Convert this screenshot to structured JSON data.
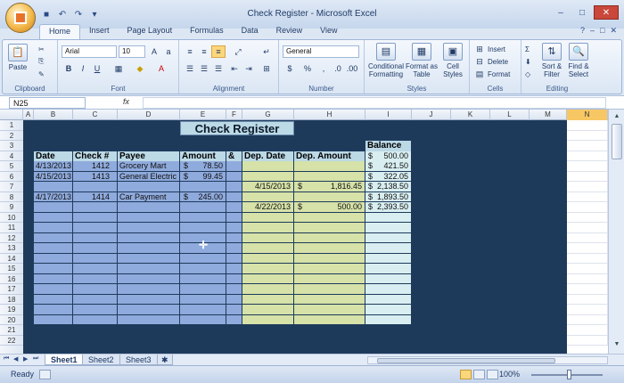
{
  "app": {
    "title": "Check Register - Microsoft Excel"
  },
  "tabs": [
    "Home",
    "Insert",
    "Page Layout",
    "Formulas",
    "Data",
    "Review",
    "View"
  ],
  "ribbon": {
    "clipboard": {
      "label": "Clipboard",
      "paste": "Paste"
    },
    "font": {
      "label": "Font",
      "name": "Arial",
      "size": "10",
      "bold": "B",
      "italic": "I",
      "underline": "U"
    },
    "alignment": {
      "label": "Alignment"
    },
    "number": {
      "label": "Number",
      "format": "General",
      "currency": "$",
      "percent": "%",
      "comma": ","
    },
    "styles": {
      "label": "Styles",
      "conditional": "Conditional Formatting",
      "format_table": "Format as Table",
      "cell_styles": "Cell Styles"
    },
    "cells": {
      "label": "Cells",
      "insert": "Insert",
      "delete": "Delete",
      "format": "Format"
    },
    "editing": {
      "label": "Editing",
      "sort": "Sort & Filter",
      "find": "Find & Select"
    }
  },
  "formula_bar": {
    "namebox": "N25",
    "fx": "fx",
    "value": ""
  },
  "columns": [
    "A",
    "B",
    "C",
    "D",
    "E",
    "F",
    "G",
    "H",
    "I",
    "J",
    "K",
    "L",
    "M",
    "N"
  ],
  "rows": [
    "1",
    "2",
    "3",
    "4",
    "5",
    "6",
    "7",
    "8",
    "9",
    "10",
    "11",
    "12",
    "13",
    "14",
    "15",
    "16",
    "17",
    "18",
    "19",
    "20",
    "21",
    "22"
  ],
  "sheet": {
    "title": "Check Register",
    "balance_header": "Balance",
    "headers": {
      "date": "Date",
      "check": "Check #",
      "payee": "Payee",
      "amount": "Amount",
      "amp": "&",
      "dep_date": "Dep. Date",
      "dep_amount": "Dep. Amount"
    },
    "transactions": [
      {
        "date": "4/13/2013",
        "check": "1412",
        "payee": "Grocery Mart",
        "amount_sym": "$",
        "amount": "78.50"
      },
      {
        "date": "4/15/2013",
        "check": "1413",
        "payee": "General Electric",
        "amount_sym": "$",
        "amount": "99.45"
      },
      {
        "date": "4/17/2013",
        "check": "1414",
        "payee": "Car Payment",
        "amount_sym": "$",
        "amount": "245.00"
      }
    ],
    "deposits": [
      {
        "date": "4/15/2013",
        "sym": "$",
        "amount": "1,816.45"
      },
      {
        "date": "4/22/2013",
        "sym": "$",
        "amount": "500.00"
      }
    ],
    "balances": [
      {
        "sym": "$",
        "value": "500.00"
      },
      {
        "sym": "$",
        "value": "421.50"
      },
      {
        "sym": "$",
        "value": "322.05"
      },
      {
        "sym": "$",
        "value": "2,138.50"
      },
      {
        "sym": "$",
        "value": "1,893.50"
      },
      {
        "sym": "$",
        "value": "2,393.50"
      }
    ]
  },
  "sheet_tabs": [
    "Sheet1",
    "Sheet2",
    "Sheet3"
  ],
  "status": {
    "ready": "Ready",
    "zoom": "100%"
  },
  "colors": {
    "ledger": "#8faadc",
    "deposit": "#d6e2a8",
    "balance": "#d9eef1",
    "background": "#1e3a5b",
    "header": "#bcd9e6"
  }
}
